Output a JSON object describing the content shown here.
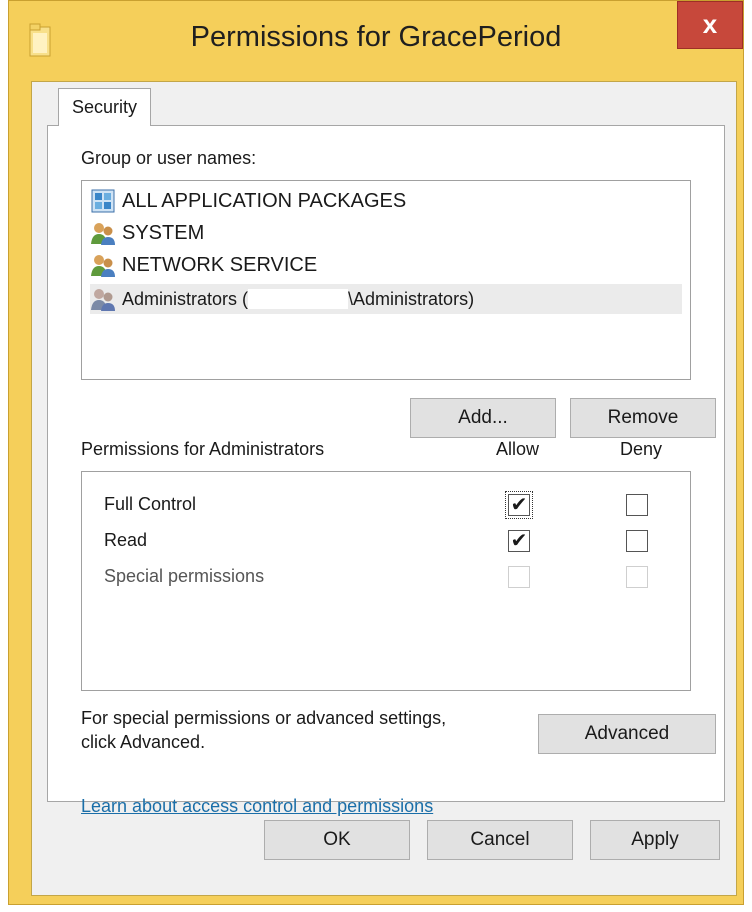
{
  "window": {
    "title": "Permissions for GracePeriod",
    "close_label": "x"
  },
  "tab": {
    "label": "Security"
  },
  "group": {
    "label": "Group or user names:",
    "items": [
      {
        "name": "ALL APPLICATION PACKAGES",
        "icon": "app-packages-icon"
      },
      {
        "name": "SYSTEM",
        "icon": "users-icon"
      },
      {
        "name": "NETWORK SERVICE",
        "icon": "users-icon"
      },
      {
        "name_prefix": "Administrators (",
        "name_suffix": "\\Administrators)",
        "icon": "users-icon",
        "selected": true
      }
    ],
    "add_label": "Add...",
    "remove_label": "Remove"
  },
  "permissions": {
    "label": "Permissions for Administrators",
    "allow_header": "Allow",
    "deny_header": "Deny",
    "rows": [
      {
        "name": "Full Control",
        "allow": true,
        "deny": false
      },
      {
        "name": "Read",
        "allow": true,
        "deny": false
      },
      {
        "name": "Special permissions",
        "allow": false,
        "deny": false
      }
    ]
  },
  "advanced": {
    "text_line1": "For special permissions or advanced settings,",
    "text_line2": "click Advanced.",
    "button_label": "Advanced"
  },
  "link_text": "Learn about access control and permissions",
  "footer": {
    "ok": "OK",
    "cancel": "Cancel",
    "apply": "Apply"
  },
  "colors": {
    "frame": "#f5cf5a",
    "close": "#c7483b",
    "link": "#1a6ea8"
  }
}
